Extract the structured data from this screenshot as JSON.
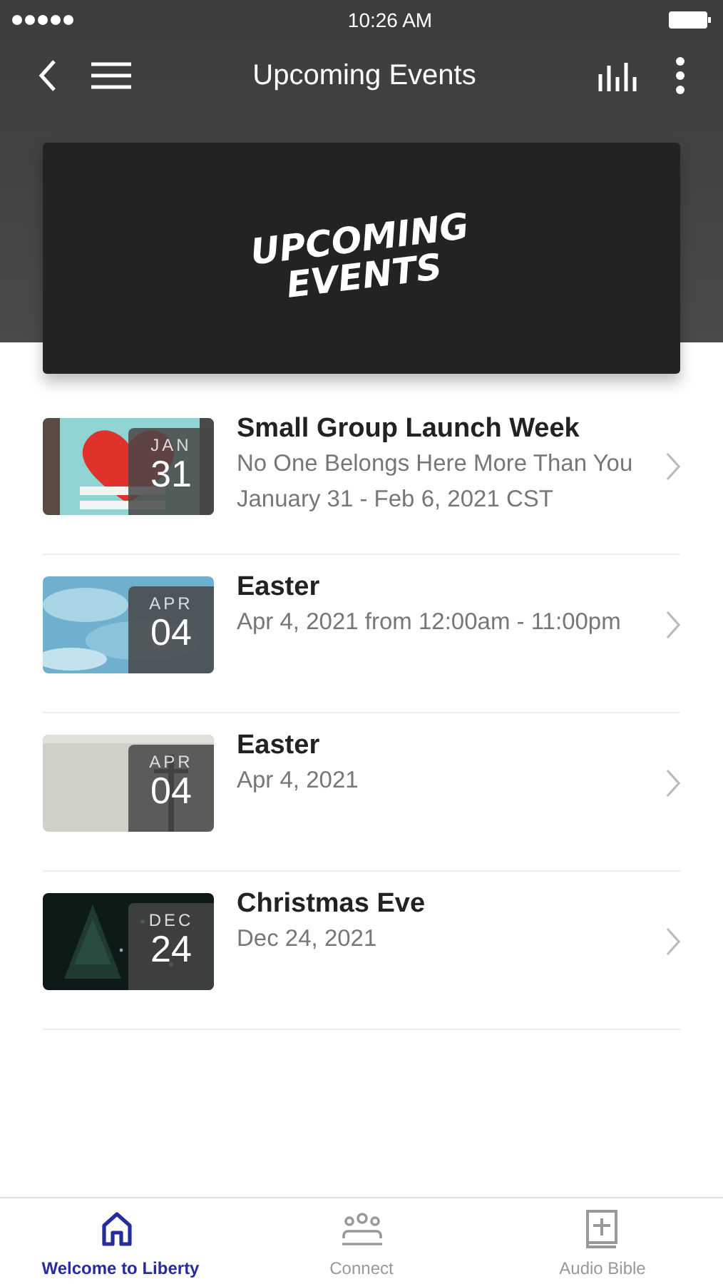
{
  "status_bar": {
    "time": "10:26 AM"
  },
  "header": {
    "title": "Upcoming Events"
  },
  "banner": {
    "lines": [
      "UPCOMING",
      "EVENTS"
    ]
  },
  "events": [
    {
      "title": "Small Group Launch Week",
      "lines": [
        "No One Belongs Here More Than You",
        "January 31 - Feb 6, 2021 CST"
      ],
      "month": "JAN",
      "day": "31"
    },
    {
      "title": "Easter",
      "lines": [
        "Apr 4, 2021 from 12:00am - 11:00pm"
      ],
      "month": "APR",
      "day": "04"
    },
    {
      "title": "Easter",
      "lines": [
        "Apr 4, 2021"
      ],
      "month": "APR",
      "day": "04"
    },
    {
      "title": "Christmas Eve",
      "lines": [
        "Dec 24, 2021"
      ],
      "month": "DEC",
      "day": "24"
    }
  ],
  "tabs": [
    {
      "label": "Welcome to Liberty",
      "selected": true
    },
    {
      "label": "Connect",
      "selected": false
    },
    {
      "label": "Audio Bible",
      "selected": false
    }
  ]
}
